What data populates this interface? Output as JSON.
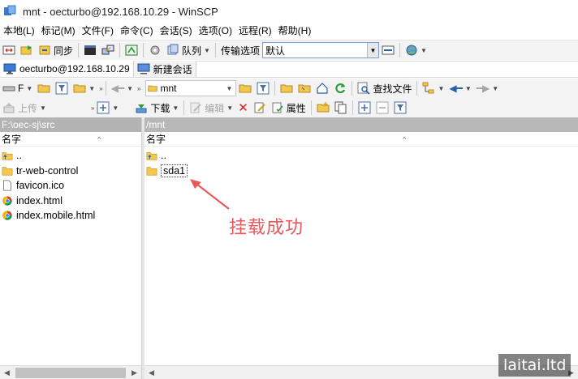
{
  "window": {
    "title": "mnt - oecturbo@192.168.10.29 - WinSCP"
  },
  "menu": [
    "本地(L)",
    "标记(M)",
    "文件(F)",
    "命令(C)",
    "会话(S)",
    "选项(O)",
    "远程(R)",
    "帮助(H)"
  ],
  "toolbar1": {
    "sync_label": "同步",
    "queue_label": "队列",
    "transfer_options_label": "传输选项",
    "transfer_preset": "默认"
  },
  "tabs": {
    "session": "oecturbo@192.168.10.29",
    "new_session": "新建会话"
  },
  "local_toolbar": {
    "drive": "F",
    "upload_label": "上传"
  },
  "remote_toolbar": {
    "folder": "mnt",
    "find_label": "查找文件",
    "download_label": "下载",
    "edit_label": "编辑",
    "properties_label": "属性"
  },
  "local_panel": {
    "path": "F:\\oec-sj\\src",
    "column_name": "名字",
    "items": [
      {
        "name": "..",
        "kind": "parent-folder-icon"
      },
      {
        "name": "tr-web-control",
        "kind": "folder-icon"
      },
      {
        "name": "favicon.ico",
        "kind": "file-icon"
      },
      {
        "name": "index.html",
        "kind": "chrome-icon"
      },
      {
        "name": "index.mobile.html",
        "kind": "chrome-icon"
      }
    ]
  },
  "remote_panel": {
    "path": "/mnt",
    "column_name": "名字",
    "items": [
      {
        "name": "..",
        "kind": "parent-folder-icon"
      },
      {
        "name": "sda1",
        "kind": "folder-icon"
      }
    ]
  },
  "annotation": {
    "text": "挂载成功",
    "color": "#e8585c"
  },
  "watermark": {
    "text": "laitai.ltd"
  },
  "colors": {
    "folder": "#f2c94c",
    "path_bar": "#b3b3b3",
    "accent": "#2f6fc9"
  }
}
